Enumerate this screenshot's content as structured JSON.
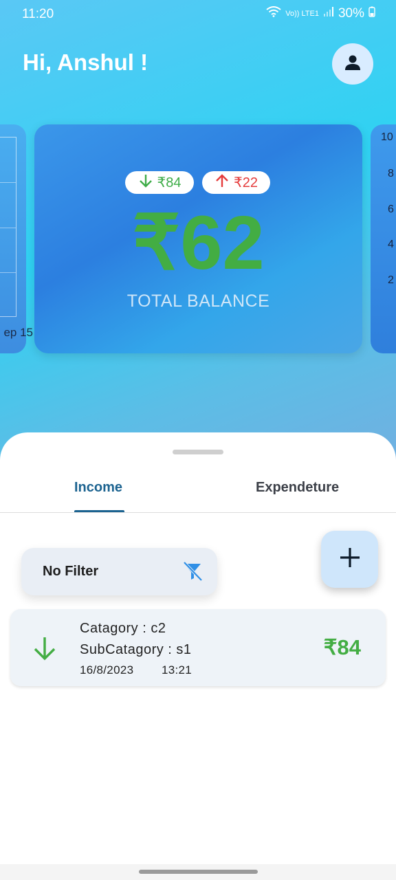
{
  "status_bar": {
    "time": "11:20",
    "network": "Vo)) LTE1",
    "battery": "30%"
  },
  "header": {
    "greeting": "Hi, Anshul !",
    "profile_icon": "person-icon"
  },
  "carousel": {
    "left_card_label": "ep 15",
    "right_card_ticks": [
      "10",
      "8",
      "6",
      "4",
      "2"
    ],
    "balance_card": {
      "income_pill": "₹84",
      "expense_pill": "₹22",
      "total_amount": "₹62",
      "total_label": "TOTAL BALANCE"
    }
  },
  "tabs": [
    {
      "label": "Income",
      "selected": true
    },
    {
      "label": "Expendeture",
      "selected": false
    }
  ],
  "filter": {
    "label": "No Filter",
    "icon": "filter-off-icon"
  },
  "fab": {
    "icon": "plus-icon"
  },
  "entries": [
    {
      "category": "Catagory : c2",
      "subcategory": "SubCatagory : s1",
      "date": "16/8/2023",
      "time": "13:21",
      "amount": "₹84",
      "icon": "arrow-down-icon"
    }
  ],
  "colors": {
    "income_green": "#43ad43",
    "expense_red": "#e53b3b",
    "tab_active": "#1c6390"
  }
}
